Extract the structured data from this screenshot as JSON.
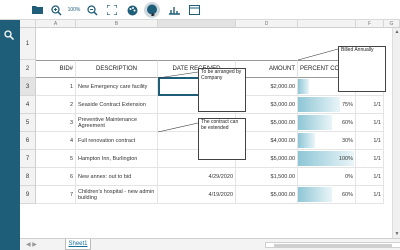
{
  "toolbar": {
    "buttons": [
      {
        "name": "open-folder-icon"
      },
      {
        "name": "zoom-in-icon"
      },
      {
        "name": "fit-width-icon",
        "label": "100%"
      },
      {
        "name": "zoom-out-icon"
      },
      {
        "name": "fullscreen-icon"
      },
      {
        "name": "theme-palette-icon"
      },
      {
        "name": "comment-icon"
      },
      {
        "name": "chart-settings-icon"
      },
      {
        "name": "window-icon"
      }
    ]
  },
  "columns": [
    "A",
    "B",
    "",
    "D",
    "",
    "F",
    "G",
    "H"
  ],
  "headers": {
    "bid": "BID#",
    "description": "DESCRIPTION",
    "date_received": "DATE RECEIVED",
    "amount": "AMOUNT",
    "percent": "PERCENT CO"
  },
  "rows": [
    {
      "row": "3",
      "bid": "1",
      "description": "New Emergency care facility",
      "date": "",
      "amount": "$2,000.00",
      "percent": "",
      "fill": 0.2,
      "extra": ""
    },
    {
      "row": "4",
      "bid": "2",
      "description": "Seaside Contract Extension",
      "date": "",
      "amount": "$3,000.00",
      "percent": "75%",
      "fill": 0.75,
      "extra": "1/1"
    },
    {
      "row": "5",
      "bid": "3",
      "description": "Preventive Maintenance Agreement",
      "date": "",
      "amount": "$5,000.00",
      "percent": "60%",
      "fill": 0.6,
      "extra": "1/1"
    },
    {
      "row": "6",
      "bid": "4",
      "description": "Full renovation contract",
      "date": "",
      "amount": "$4,000.00",
      "percent": "30%",
      "fill": 0.3,
      "extra": "1/1"
    },
    {
      "row": "7",
      "bid": "5",
      "description": "Hampton Inn, Burlington",
      "date": "",
      "amount": "$5,000.00",
      "percent": "100%",
      "fill": 1.0,
      "extra": "1/1"
    },
    {
      "row": "8",
      "bid": "6",
      "description": "New annex: out to bid",
      "date": "4/29/2020",
      "amount": "$1,500.00",
      "percent": "0%",
      "fill": 0.0,
      "extra": "1/1"
    },
    {
      "row": "9",
      "bid": "7",
      "description": "Children's hospital - new admin building",
      "date": "4/19/2020",
      "amount": "$5,000.00",
      "percent": "60%",
      "fill": 0.6,
      "extra": "1/1"
    }
  ],
  "row_numbers": [
    "1",
    "2",
    "3",
    "4",
    "5",
    "6",
    "7",
    "8",
    "9"
  ],
  "notes": {
    "billed": "Billed Annually",
    "arranged": "To be arranged by Company",
    "extended": "The contract can be extended"
  },
  "sheet_tab": "Sheet1",
  "colors": {
    "accent": "#1f5e78",
    "bar": "#8ec6d6"
  }
}
